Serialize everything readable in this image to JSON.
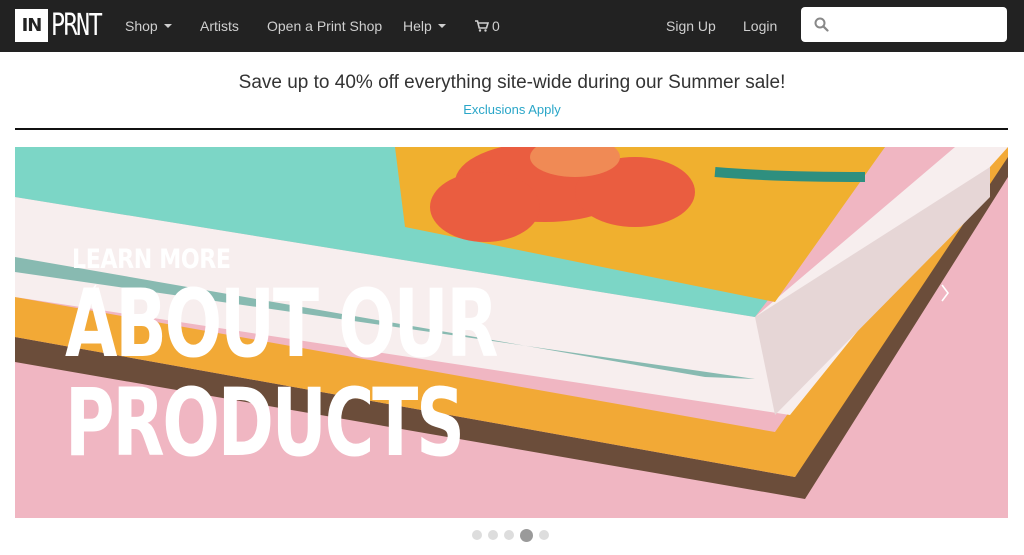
{
  "brand": {
    "logo_left": "IN",
    "logo_right": "PRNT"
  },
  "nav": {
    "shop": "Shop",
    "artists": "Artists",
    "open_shop": "Open a Print Shop",
    "help": "Help",
    "cart_count": "0",
    "sign_up": "Sign Up",
    "login": "Login"
  },
  "search": {
    "placeholder": ""
  },
  "promo": {
    "text": "Save up to 40% off everything site-wide during our Summer sale!",
    "link": "Exclusions Apply"
  },
  "hero": {
    "kicker": "LEARN MORE",
    "line1": "ABOUT OUR",
    "line2": "PRODUCTS",
    "slide_count": 5,
    "active_slide": 4
  },
  "colors": {
    "nav_bg": "#222222",
    "accent_link": "#2aa6c8",
    "hero_bg": "#f0b6c2"
  },
  "icons": {
    "search": "search-icon",
    "cart": "cart-icon",
    "prev": "chevron-left-icon",
    "next": "chevron-right-icon"
  }
}
